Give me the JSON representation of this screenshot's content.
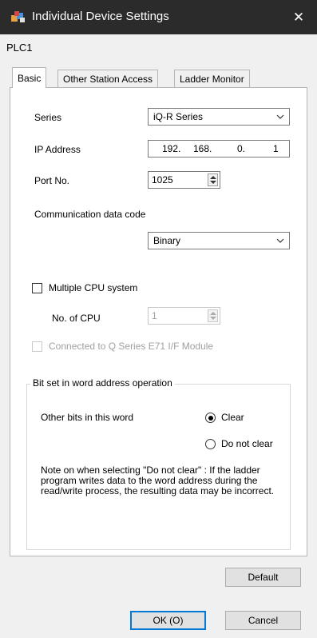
{
  "window": {
    "title": "Individual Device Settings",
    "close_glyph": "✕",
    "icon": "app-cubes-icon"
  },
  "device_label": "PLC1",
  "tabs": [
    {
      "label": "Basic",
      "active": true
    },
    {
      "label": "Other Station Access",
      "active": false
    },
    {
      "label": "Ladder Monitor",
      "active": false
    }
  ],
  "basic": {
    "series_label": "Series",
    "series_value": "iQ-R Series",
    "ip_label": "IP Address",
    "ip_parts": [
      "192.",
      "168.",
      "0.",
      "1"
    ],
    "port_label": "Port No.",
    "port_value": "1025",
    "comm_code_label": "Communication data code",
    "comm_code_value": "Binary",
    "multiple_cpu_label": "Multiple CPU system",
    "multiple_cpu_checked": false,
    "num_cpu_label": "No. of CPU",
    "num_cpu_value": "1",
    "q_series_label": "Connected to Q Series E71 I/F Module",
    "q_series_checked": false
  },
  "bitset": {
    "group_title": "Bit set in word address operation",
    "other_bits_label": "Other bits in this word",
    "options": [
      {
        "label": "Clear",
        "selected": true
      },
      {
        "label": "Do not clear",
        "selected": false
      }
    ],
    "note": "Note on when selecting \"Do not clear\" : If the ladder program writes data to the word address during the read/write process, the resulting data may be incorrect."
  },
  "buttons": {
    "default": "Default",
    "ok": "OK (O)",
    "cancel": "Cancel"
  },
  "colors": {
    "titlebar": "#2b2b2b",
    "focus_border": "#0078d7"
  }
}
